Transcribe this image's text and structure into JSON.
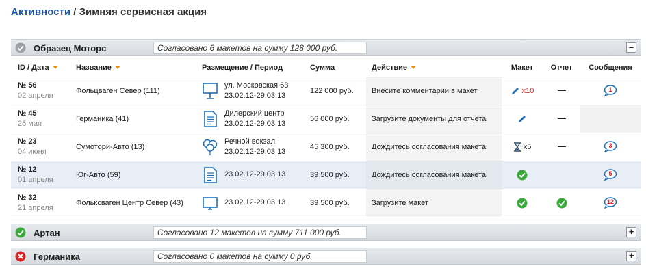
{
  "header": {
    "breadcrumb_link": "Активности",
    "separator": " / ",
    "page_title": "Зимняя сервисная акция"
  },
  "groups": [
    {
      "name": "Образец Моторс",
      "summary": "Согласовано 6 макетов на сумму 128 000 руб.",
      "toggle": "–",
      "status_icon": "check-gray-icon"
    },
    {
      "name": "Артан",
      "summary": "Согласовано 12 макетов на сумму 711 000 руб.",
      "toggle": "+",
      "status_icon": "check-green-icon"
    },
    {
      "name": "Германика",
      "summary": "Согласовано 0 макетов на сумму 0 руб.",
      "toggle": "+",
      "status_icon": "cross-red-icon"
    }
  ],
  "table": {
    "columns": [
      "ID / Дата",
      "Название",
      "Размещение / Период",
      "Сумма",
      "Действие",
      "Макет",
      "Отчет",
      "Сообщения"
    ],
    "rows": [
      {
        "id": "№ 56",
        "date": "02 апреля",
        "name": "Фольцваген Север (111)",
        "place_icon": "billboard-icon",
        "place_line1": "ул. Московская 63",
        "place_line2": "23.02.12-29.03.13",
        "sum": "122 000 руб.",
        "action": "Внесите комментарии в макет",
        "maket_icon": "pencil-icon",
        "maket_count": "x10",
        "report": "—",
        "messages": "1"
      },
      {
        "id": "№ 45",
        "date": "25 мая",
        "name": "Германика (41)",
        "place_icon": "document-icon",
        "place_line1": "Дилерский центр",
        "place_line2": "23.02.12-29.03.13",
        "sum": "56 000 руб.",
        "action": "Загрузите документы для отчета",
        "maket_icon": "pencil-icon",
        "maket_count": "",
        "report": "—",
        "messages": ""
      },
      {
        "id": "№ 23",
        "date": "04 июня",
        "name": "Сумотори-Авто (13)",
        "place_icon": "balloons-icon",
        "place_line1": "Речной вокзал",
        "place_line2": "23.02.12-29.03.13",
        "sum": "45 300 руб.",
        "action": "Дождитесь согласования макета",
        "maket_icon": "hourglass-icon",
        "maket_count": "x5",
        "report": "—",
        "messages": "3"
      },
      {
        "id": "№ 12",
        "date": "01 апреля",
        "name": "Юг-Авто (59)",
        "place_icon": "document-icon",
        "place_line1": "23.02.12-29.03.13",
        "place_line2": "",
        "sum": "39 500 руб.",
        "action": "Дождитесь согласования макета",
        "maket_icon": "check-green-icon",
        "maket_count": "",
        "report": "",
        "messages": "5"
      },
      {
        "id": "№ 32",
        "date": "21 апреля",
        "name": "Фольксваген Центр Север (43)",
        "place_icon": "monitor-icon",
        "place_line1": "23.02.12-29.03.13",
        "place_line2": "",
        "sum": "39 500 руб.",
        "action": "Загрузите макет",
        "maket_icon": "check-green-icon",
        "maket_count": "",
        "report": "check",
        "messages": "12"
      }
    ]
  },
  "colors": {
    "link": "#1c5aa6",
    "sort_arrow": "#f08a00",
    "ok_green": "#3aa83a",
    "error_red": "#d22222",
    "bubble_blue": "#1d6fb8"
  }
}
